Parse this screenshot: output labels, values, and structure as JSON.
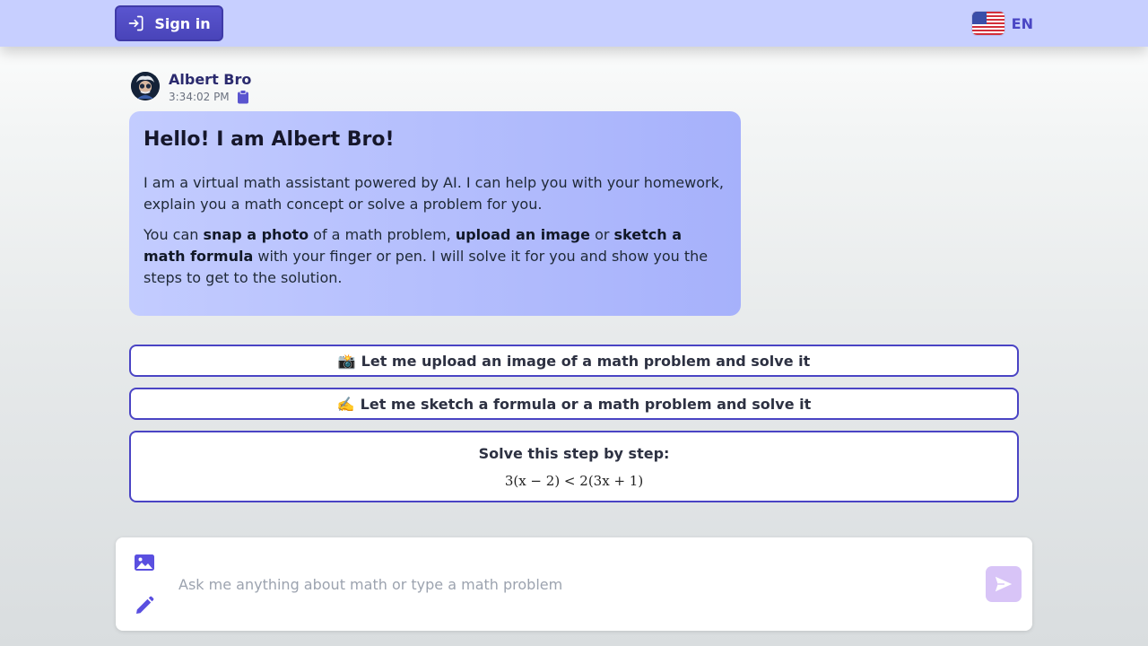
{
  "header": {
    "signin_label": "Sign in",
    "language_code": "EN",
    "language_flag": "us-flag-icon"
  },
  "message": {
    "author": "Albert Bro",
    "time": "3:34:02 PM",
    "title": "Hello! I am Albert Bro!",
    "intro": "I am a virtual math assistant powered by AI. I can help you with your homework, explain you a math concept or solve a problem for you.",
    "body": {
      "t1": "You can ",
      "b1": "snap a photo",
      "t2": " of a math problem, ",
      "b2": "upload an image",
      "t3": " or ",
      "b3": "sketch a math formula",
      "t4": " with your finger or pen. I will solve it for you and show you the steps to get to the solution."
    }
  },
  "options": [
    {
      "emoji": "📸",
      "label": "Let me upload an image of a math problem and solve it"
    },
    {
      "emoji": "✍️",
      "label": "Let me sketch a formula or a math problem and solve it"
    },
    {
      "label": "Solve this step by step:",
      "formula": "3(x − 2) < 2(3x + 1)"
    }
  ],
  "composer": {
    "placeholder": "Ask me anything about math or type a math problem",
    "value": ""
  },
  "colors": {
    "accent": "#4a44c4",
    "topbar": "#c7cfff",
    "send_button": "#d8c4f7"
  }
}
